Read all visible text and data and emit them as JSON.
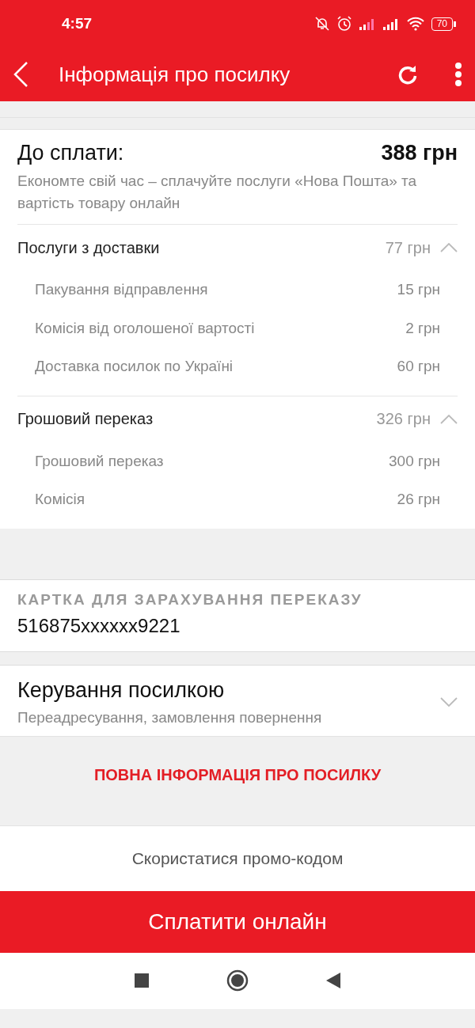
{
  "status_bar": {
    "time": "4:57",
    "battery": "70"
  },
  "app_bar": {
    "title": "Інформація про посилку"
  },
  "payment": {
    "title": "До сплати:",
    "total": "388 грн",
    "note": "Економте свій час – сплачуйте послуги «Нова Пошта» та вартість товару онлайн",
    "sections": [
      {
        "title": "Послуги з доставки",
        "amount": "77 грн",
        "expanded": true,
        "items": [
          {
            "label": "Пакування відправлення",
            "amount": "15 грн"
          },
          {
            "label": "Комісія від оголошеної вартості",
            "amount": "2 грн"
          },
          {
            "label": "Доставка посилок по Україні",
            "amount": "60 грн"
          }
        ]
      },
      {
        "title": "Грошовий переказ",
        "amount": "326 грн",
        "expanded": true,
        "items": [
          {
            "label": "Грошовий переказ",
            "amount": "300 грн"
          },
          {
            "label": "Комісія",
            "amount": "26 грн"
          }
        ]
      }
    ]
  },
  "card": {
    "label": "КАРТКА ДЛЯ ЗАРАХУВАННЯ ПЕРЕКАЗУ",
    "number": "516875xxxxxx9221"
  },
  "management": {
    "title": "Керування посилкою",
    "subtitle": "Переадресування, замовлення повернення",
    "expanded": false
  },
  "full_info_link": "ПОВНА ІНФОРМАЦІЯ ПРО ПОСИЛКУ",
  "promo_button": "Скористатися промо-кодом",
  "pay_button": "Сплатити онлайн"
}
